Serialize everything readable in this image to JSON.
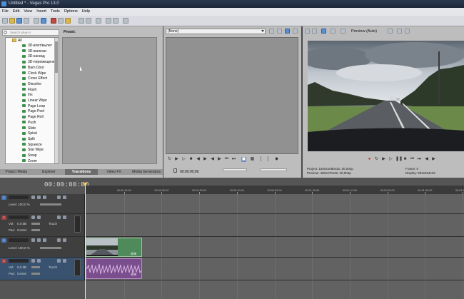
{
  "window": {
    "title": "Untitled * - Vegas Pro 13.0"
  },
  "menu": [
    "File",
    "Edit",
    "View",
    "Insert",
    "Tools",
    "Options",
    "Help"
  ],
  "left_panel": {
    "search_placeholder": "Search plug-in",
    "preset_label": "Preset:",
    "tree_root": "All",
    "transitions": [
      "3D-влет/вылет",
      "3D-жалюзи",
      "3D-каскад",
      "3D-перемещение",
      "Barn Door",
      "Clock Wipe",
      "Cross Effect",
      "Dissolve",
      "Flash",
      "Iris",
      "Linear Wipe",
      "Page Loop",
      "Page Peel",
      "Page Roll",
      "Push",
      "Slide",
      "Spiral",
      "Split",
      "Squeeze",
      "Star Wipe",
      "Swap",
      "Zoom"
    ],
    "tabs": [
      "Project Media",
      "Explorer",
      "Transitions",
      "Video FX",
      "Media Generators"
    ],
    "active_tab": "Transitions"
  },
  "mid_panel": {
    "source": "(None)",
    "time": "00:00:00;00"
  },
  "right_panel": {
    "preview_mode": "Preview (Auto)",
    "project_label": "Project:",
    "project_value": "1920x1080x32; 30,004p",
    "preview_label": "Preview:",
    "preview_value": "480x270x32; 30,004p",
    "frame_label": "Frame:",
    "frame_value": "0",
    "display_label": "Display:",
    "display_value": "593x334x32"
  },
  "timeline": {
    "timecode": "00:00:00:00",
    "ruler_marks": [
      "00:00:00:00",
      "00:00:10:00",
      "00:00:20:00",
      "00:00:30:00",
      "00:00:40:00",
      "00:00:50:00",
      "00:01:00:00",
      "00:01:10:00",
      "00:01:20:00",
      "00:01:30:00",
      "00:01:40:00"
    ],
    "tracks": [
      {
        "type": "video",
        "number": "1",
        "level_label": "Level: 100,0 %"
      },
      {
        "type": "audio",
        "number": "2",
        "vol_label": "Vol:",
        "vol_value": "0,0 dB",
        "touch": "Touch",
        "pan_label": "Pan:",
        "pan_value": "Center"
      },
      {
        "type": "video",
        "number": "3",
        "level_label": "Level: 100,0 %"
      },
      {
        "type": "audio",
        "number": "4",
        "vol_label": "Vol:",
        "vol_value": "0,0 dB",
        "touch": "Touch",
        "pan_label": "Pan:",
        "pan_value": "Center"
      }
    ]
  },
  "colors": {
    "video_clip": "#4f8a5b",
    "audio_clip": "#7a4d8d",
    "playhead_marker": "#f0c040"
  }
}
